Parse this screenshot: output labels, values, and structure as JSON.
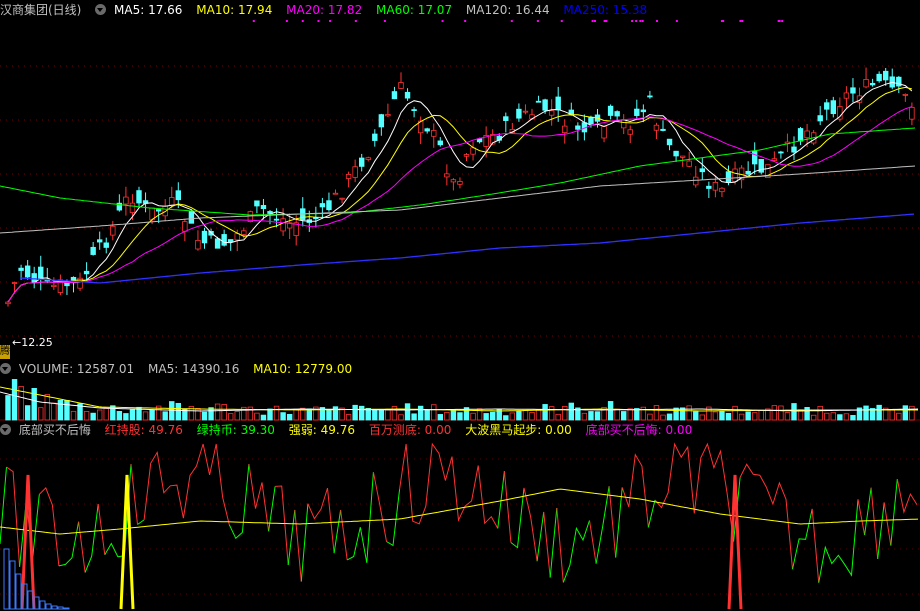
{
  "header": {
    "stock_title": "汉商集团(日线)",
    "ma": [
      {
        "label": "MA5: 17.66",
        "color": "#ffffff"
      },
      {
        "label": "MA10: 17.94",
        "color": "#ffff00"
      },
      {
        "label": "MA20: 17.82",
        "color": "#ff00ff"
      },
      {
        "label": "MA60: 17.07",
        "color": "#00ff00"
      },
      {
        "label": "MA120: 16.44",
        "color": "#c0c0c0"
      },
      {
        "label": "MA250: 15.38",
        "color": "#0000ff"
      }
    ]
  },
  "price_panel": {
    "low_label": "12.25",
    "side_tag": "腾",
    "up_color": "#ff3232",
    "down_color": "#54ffff"
  },
  "volume_panel": {
    "labels": [
      {
        "label": "VOLUME: 12587.01",
        "color": "#c0c0c0"
      },
      {
        "label": "MA5: 14390.16",
        "color": "#c0c0c0"
      },
      {
        "label": "MA10: 12779.00",
        "color": "#ffff00"
      }
    ]
  },
  "indicator_panel": {
    "name": "底部买不后悔",
    "labels": [
      {
        "label": "红持股: 49.76",
        "color": "#ff3232"
      },
      {
        "label": "绿持币: 39.30",
        "color": "#00ff00"
      },
      {
        "label": "强弱: 49.76",
        "color": "#ffff00"
      },
      {
        "label": "百万测底: 0.00",
        "color": "#ff3232"
      },
      {
        "label": "大波黑马起步: 0.00",
        "color": "#ffff00"
      },
      {
        "label": "底部买不后悔: 0.00",
        "color": "#ff00ff"
      }
    ]
  }
}
